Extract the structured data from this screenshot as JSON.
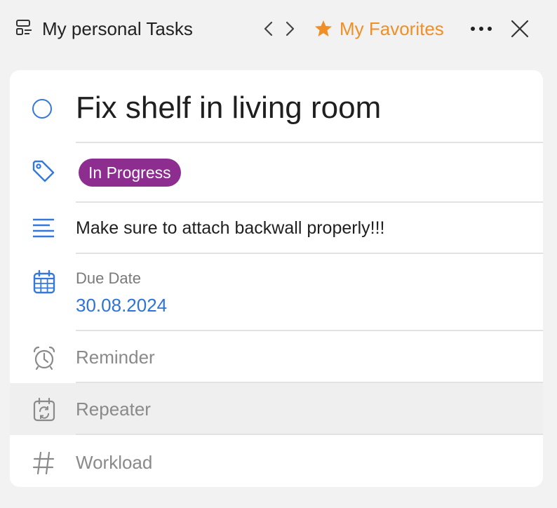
{
  "header": {
    "list_icon": "list-layout-icon",
    "title": "My personal Tasks",
    "nav_prev_icon": "chevron-left-icon",
    "nav_next_icon": "chevron-right-icon",
    "favorites_icon": "star-icon",
    "favorites_label": "My Favorites",
    "more_icon": "more-horizontal-icon",
    "close_icon": "close-icon"
  },
  "task": {
    "title": "Fix shelf in living room",
    "status_icon": "circle-outline-icon",
    "tag_icon": "tag-icon",
    "tag_label": "In Progress",
    "note_icon": "text-lines-icon",
    "note": "Make sure to attach backwall properly!!!",
    "due_icon": "calendar-icon",
    "due_label": "Due Date",
    "due_value": "30.08.2024",
    "reminder_icon": "alarm-clock-icon",
    "reminder_label": "Reminder",
    "repeater_icon": "calendar-repeat-icon",
    "repeater_label": "Repeater",
    "workload_icon": "hash-icon",
    "workload_label": "Workload"
  },
  "colors": {
    "accent_blue": "#3478dc",
    "favorites_orange": "#ef8f26",
    "tag_purple": "#8d2d8f",
    "background": "#f2f2f2"
  }
}
